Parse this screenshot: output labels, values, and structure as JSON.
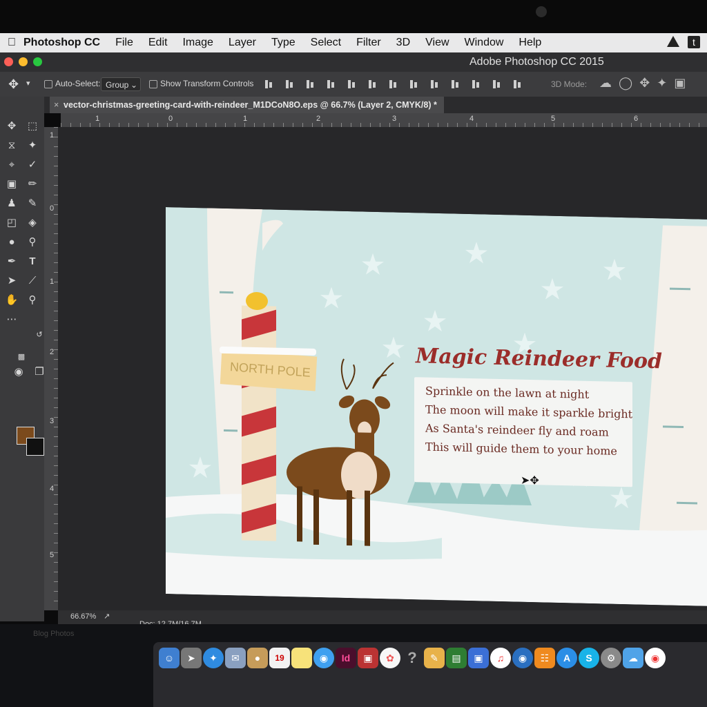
{
  "menubar": {
    "app_name": "Photoshop CC",
    "items": [
      "File",
      "Edit",
      "Image",
      "Layer",
      "Type",
      "Select",
      "Filter",
      "3D",
      "View",
      "Window",
      "Help"
    ]
  },
  "window": {
    "title": "Adobe Photoshop CC 2015"
  },
  "options_bar": {
    "auto_select_label": "Auto-Select:",
    "auto_select_value": "Group",
    "show_transform_label": "Show Transform Controls",
    "mode_3d_label": "3D Mode:"
  },
  "document": {
    "tab_title": "vector-christmas-greeting-card-with-reindeer_M1DCoN8O.eps @ 66.7% (Layer 2, CMYK/8) *"
  },
  "rulers": {
    "horizontal": [
      "1",
      "0",
      "1",
      "2",
      "3",
      "4",
      "5",
      "6"
    ],
    "vertical": [
      "1",
      "0",
      "1",
      "2",
      "3",
      "4",
      "5"
    ]
  },
  "card": {
    "title": "Magic Reindeer Food",
    "poem": [
      "Sprinkle on the lawn at night",
      "The moon will make it sparkle bright",
      "As Santa's reindeer fly and roam",
      "This will guide them to your home"
    ],
    "sign_text": "NORTH POLE",
    "colors": {
      "sky": "#cfe6e4",
      "title": "#9b2d2a",
      "stripe": "#c8363a",
      "deer": "#7b4a1c"
    }
  },
  "tools": {
    "foreground_color": "#7b4a1c",
    "background_color": "#111111"
  },
  "status": {
    "zoom": "66.67%",
    "doc_size": "Doc: 12.7M/16.7M"
  },
  "desktop": {
    "label": "Blog Photos"
  },
  "dock": {
    "calendar_day": "19",
    "indesign_label": "Id"
  }
}
